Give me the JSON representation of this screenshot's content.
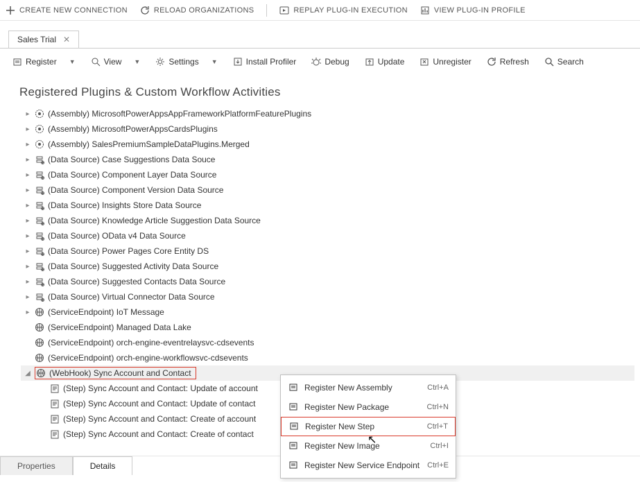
{
  "topbar": {
    "create": "CREATE NEW CONNECTION",
    "reload": "RELOAD ORGANIZATIONS",
    "replay": "REPLAY PLUG-IN EXECUTION",
    "profile": "VIEW PLUG-IN PROFILE"
  },
  "tab": {
    "title": "Sales Trial"
  },
  "toolbar": {
    "register": "Register",
    "view": "View",
    "settings": "Settings",
    "install": "Install Profiler",
    "debug": "Debug",
    "update": "Update",
    "unregister": "Unregister",
    "refresh": "Refresh",
    "search": "Search"
  },
  "section": {
    "title": "Registered Plugins & Custom Workflow Activities"
  },
  "tree": [
    {
      "depth": 0,
      "twisty": "▸",
      "kind": "assembly",
      "label": "(Assembly) MicrosoftPowerAppsAppFrameworkPlatformFeaturePlugins"
    },
    {
      "depth": 0,
      "twisty": "▸",
      "kind": "assembly",
      "label": "(Assembly) MicrosoftPowerAppsCardsPlugins"
    },
    {
      "depth": 0,
      "twisty": "▸",
      "kind": "assembly",
      "label": "(Assembly) SalesPremiumSampleDataPlugins.Merged"
    },
    {
      "depth": 0,
      "twisty": "▸",
      "kind": "datasource",
      "label": "(Data Source) Case Suggestions Data Souce"
    },
    {
      "depth": 0,
      "twisty": "▸",
      "kind": "datasource",
      "label": "(Data Source) Component Layer Data Source"
    },
    {
      "depth": 0,
      "twisty": "▸",
      "kind": "datasource",
      "label": "(Data Source) Component Version Data Source"
    },
    {
      "depth": 0,
      "twisty": "▸",
      "kind": "datasource",
      "label": "(Data Source) Insights Store Data Source"
    },
    {
      "depth": 0,
      "twisty": "▸",
      "kind": "datasource",
      "label": "(Data Source) Knowledge Article Suggestion Data Source"
    },
    {
      "depth": 0,
      "twisty": "▸",
      "kind": "datasource",
      "label": "(Data Source) OData v4 Data Source"
    },
    {
      "depth": 0,
      "twisty": "▸",
      "kind": "datasource",
      "label": "(Data Source) Power Pages Core Entity DS"
    },
    {
      "depth": 0,
      "twisty": "▸",
      "kind": "datasource",
      "label": "(Data Source) Suggested Activity Data Source"
    },
    {
      "depth": 0,
      "twisty": "▸",
      "kind": "datasource",
      "label": "(Data Source) Suggested Contacts Data Source"
    },
    {
      "depth": 0,
      "twisty": "▸",
      "kind": "datasource",
      "label": "(Data Source) Virtual Connector Data Source"
    },
    {
      "depth": 0,
      "twisty": "▸",
      "kind": "endpoint",
      "label": "(ServiceEndpoint) IoT Message"
    },
    {
      "depth": 0,
      "twisty": "",
      "kind": "endpoint",
      "label": "(ServiceEndpoint) Managed Data Lake"
    },
    {
      "depth": 0,
      "twisty": "",
      "kind": "endpoint",
      "label": "(ServiceEndpoint) orch-engine-eventrelaysvc-cdsevents"
    },
    {
      "depth": 0,
      "twisty": "",
      "kind": "endpoint",
      "label": "(ServiceEndpoint) orch-engine-workflowsvc-cdsevents"
    },
    {
      "depth": 0,
      "twisty": "◢",
      "kind": "webhook",
      "label": "(WebHook) Sync Account and Contact",
      "selected": true
    },
    {
      "depth": 1,
      "twisty": "",
      "kind": "step",
      "label": "(Step) Sync Account and Contact: Update of account"
    },
    {
      "depth": 1,
      "twisty": "",
      "kind": "step",
      "label": "(Step) Sync Account and Contact: Update of contact"
    },
    {
      "depth": 1,
      "twisty": "",
      "kind": "step",
      "label": "(Step) Sync Account and Contact: Create of account"
    },
    {
      "depth": 1,
      "twisty": "",
      "kind": "step",
      "label": "(Step) Sync Account and Contact: Create of contact"
    }
  ],
  "bottomTabs": {
    "properties": "Properties",
    "details": "Details",
    "active": 1
  },
  "contextMenu": [
    {
      "label": "Register New Assembly",
      "shortcut": "Ctrl+A"
    },
    {
      "label": "Register New Package",
      "shortcut": "Ctrl+N"
    },
    {
      "label": "Register New Step",
      "shortcut": "Ctrl+T",
      "highlight": true
    },
    {
      "label": "Register New Image",
      "shortcut": "Ctrl+I"
    },
    {
      "label": "Register New Service Endpoint",
      "shortcut": "Ctrl+E"
    }
  ]
}
